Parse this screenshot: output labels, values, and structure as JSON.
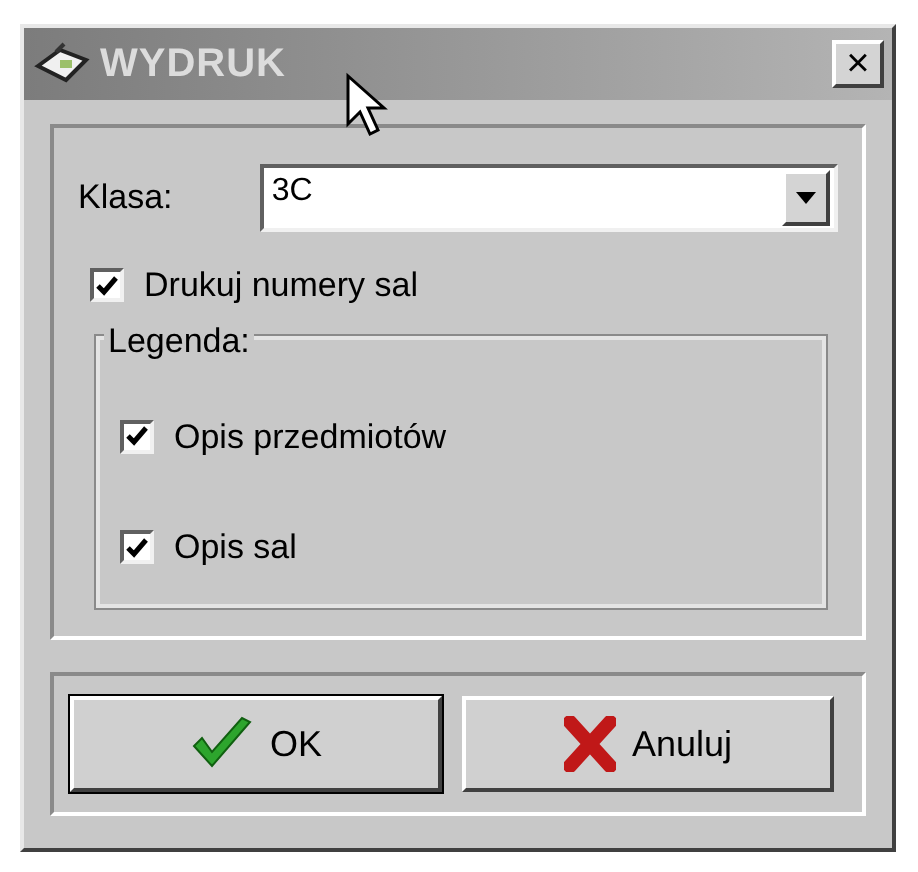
{
  "window": {
    "title": "WYDRUK",
    "close": "×"
  },
  "class_field": {
    "label": "Klasa:",
    "value": "3C"
  },
  "print_rooms": {
    "label": "Drukuj numery sal",
    "checked": true
  },
  "legend": {
    "title": "Legenda:",
    "options": [
      {
        "label": "Opis przedmiotów",
        "checked": true
      },
      {
        "label": "Opis sal",
        "checked": true
      }
    ]
  },
  "buttons": [
    {
      "kind": "ok",
      "label": "OK"
    },
    {
      "kind": "cancel",
      "label": "Anuluj"
    }
  ]
}
